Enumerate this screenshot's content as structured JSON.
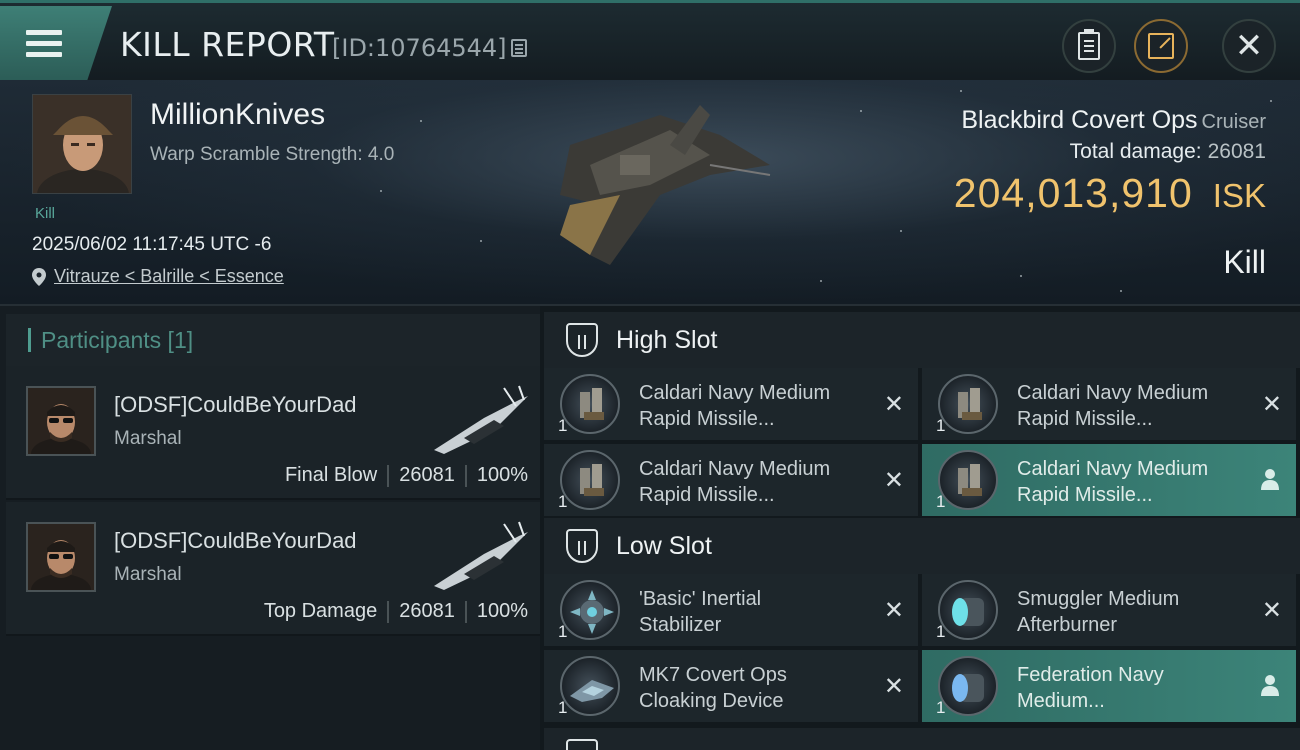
{
  "header": {
    "title": "KILL REPORT",
    "report_id": "[ID:10764544]"
  },
  "victim": {
    "name": "MillionKnives",
    "warp_scramble": "Warp Scramble Strength: 4.0",
    "tag": "Kill",
    "datetime": "2025/06/02 11:17:45 UTC -6",
    "location": "Vitrauze < Balrille < Essence"
  },
  "ship": {
    "name": "Blackbird Covert Ops",
    "class": "Cruiser",
    "total_damage_label": "Total damage:",
    "total_damage": "26081",
    "isk_value": "204,013,910",
    "isk_unit": "ISK",
    "result": "Kill"
  },
  "participants": {
    "label": "Participants [1]",
    "rows": [
      {
        "name": "[ODSF]CouldBeYourDad",
        "ship": "Marshal",
        "role": "Final Blow",
        "damage": "26081",
        "percent": "100%"
      },
      {
        "name": "[ODSF]CouldBeYourDad",
        "ship": "Marshal",
        "role": "Top Damage",
        "damage": "26081",
        "percent": "100%"
      }
    ]
  },
  "slots": {
    "high": {
      "label": "High Slot",
      "modules": [
        {
          "line1": "Caldari Navy Medium",
          "line2": "Rapid Missile...",
          "qty": "1",
          "status": "destroyed"
        },
        {
          "line1": "Caldari Navy Medium",
          "line2": "Rapid Missile...",
          "qty": "1",
          "status": "destroyed"
        },
        {
          "line1": "Caldari Navy Medium",
          "line2": "Rapid Missile...",
          "qty": "1",
          "status": "destroyed"
        },
        {
          "line1": "Caldari Navy Medium",
          "line2": "Rapid Missile...",
          "qty": "1",
          "status": "dropped"
        }
      ]
    },
    "low": {
      "label": "Low Slot",
      "modules": [
        {
          "line1": "'Basic' Inertial",
          "line2": "Stabilizer",
          "qty": "1",
          "status": "destroyed"
        },
        {
          "line1": "Smuggler Medium",
          "line2": "Afterburner",
          "qty": "1",
          "status": "destroyed"
        },
        {
          "line1": "MK7 Covert Ops",
          "line2": "Cloaking Device",
          "qty": "1",
          "status": "destroyed"
        },
        {
          "line1": "Federation Navy",
          "line2": "Medium...",
          "qty": "1",
          "status": "dropped"
        }
      ]
    }
  },
  "colors": {
    "accent": "#3c8479",
    "isk": "#f0c36d",
    "share": "#e7b35b"
  }
}
